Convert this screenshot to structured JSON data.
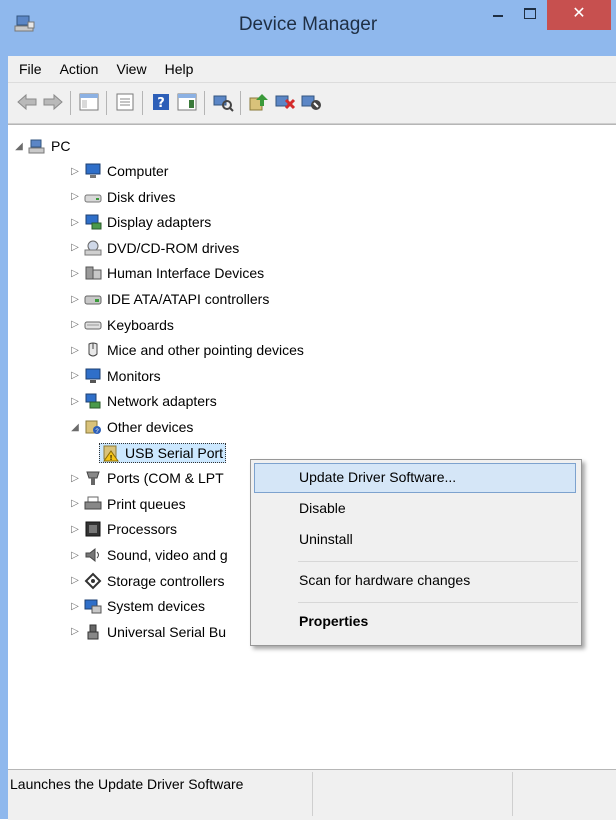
{
  "window": {
    "title": "Device Manager",
    "close_glyph": "✕"
  },
  "menu": [
    "File",
    "Action",
    "View",
    "Help"
  ],
  "toolbar": {
    "icons": [
      "back-arrow-icon",
      "forward-arrow-icon",
      "show-hide-console-tree-icon",
      "properties-sheet-icon",
      "help-icon",
      "action-pane-icon",
      "scan-hardware-icon",
      "update-driver-icon",
      "uninstall-device-icon",
      "disable-device-icon"
    ]
  },
  "tree": {
    "root": "PC",
    "categories": [
      {
        "label": "Computer",
        "icon": "computer-icon"
      },
      {
        "label": "Disk drives",
        "icon": "disk-drive-icon"
      },
      {
        "label": "Display adapters",
        "icon": "display-adapter-icon"
      },
      {
        "label": "DVD/CD-ROM drives",
        "icon": "dvd-drive-icon"
      },
      {
        "label": "Human Interface Devices",
        "icon": "hid-icon"
      },
      {
        "label": "IDE ATA/ATAPI controllers",
        "icon": "ide-controller-icon"
      },
      {
        "label": "Keyboards",
        "icon": "keyboard-icon"
      },
      {
        "label": "Mice and other pointing devices",
        "icon": "mouse-icon"
      },
      {
        "label": "Monitors",
        "icon": "monitor-icon"
      },
      {
        "label": "Network adapters",
        "icon": "network-adapter-icon"
      },
      {
        "label": "Other devices",
        "icon": "other-devices-icon",
        "expanded": true
      },
      {
        "label": "USB Serial Port",
        "icon": "unknown-device-warning-icon",
        "child": true,
        "selected": true
      },
      {
        "label": "Ports (COM & LPT",
        "icon": "port-icon"
      },
      {
        "label": "Print queues",
        "icon": "printer-icon"
      },
      {
        "label": "Processors",
        "icon": "processor-icon"
      },
      {
        "label": "Sound, video and g",
        "icon": "sound-icon"
      },
      {
        "label": "Storage controllers",
        "icon": "storage-controller-icon"
      },
      {
        "label": "System devices",
        "icon": "system-devices-icon"
      },
      {
        "label": "Universal Serial Bu",
        "icon": "usb-icon"
      }
    ]
  },
  "context_menu": {
    "items": [
      "Update Driver Software...",
      "Disable",
      "Uninstall",
      "Scan for hardware changes",
      "Properties"
    ]
  },
  "status": {
    "text": "Launches the Update Driver Software"
  },
  "colors": {
    "titlebar": "#8fb8ed",
    "close": "#c7504f",
    "selection": "#cce8ff",
    "menu_highlight": "#d5e6f7"
  }
}
